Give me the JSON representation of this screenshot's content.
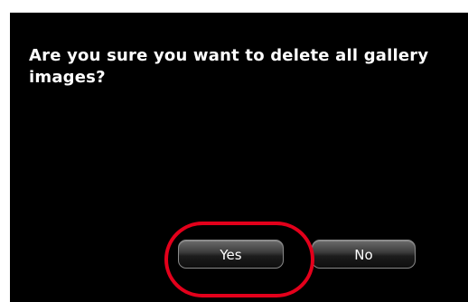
{
  "dialog": {
    "message": "Are you sure you want to delete all gallery images?",
    "yes_label": "Yes",
    "no_label": "No"
  },
  "colors": {
    "dialog_background": "#000000",
    "highlight": "#e3001b"
  }
}
